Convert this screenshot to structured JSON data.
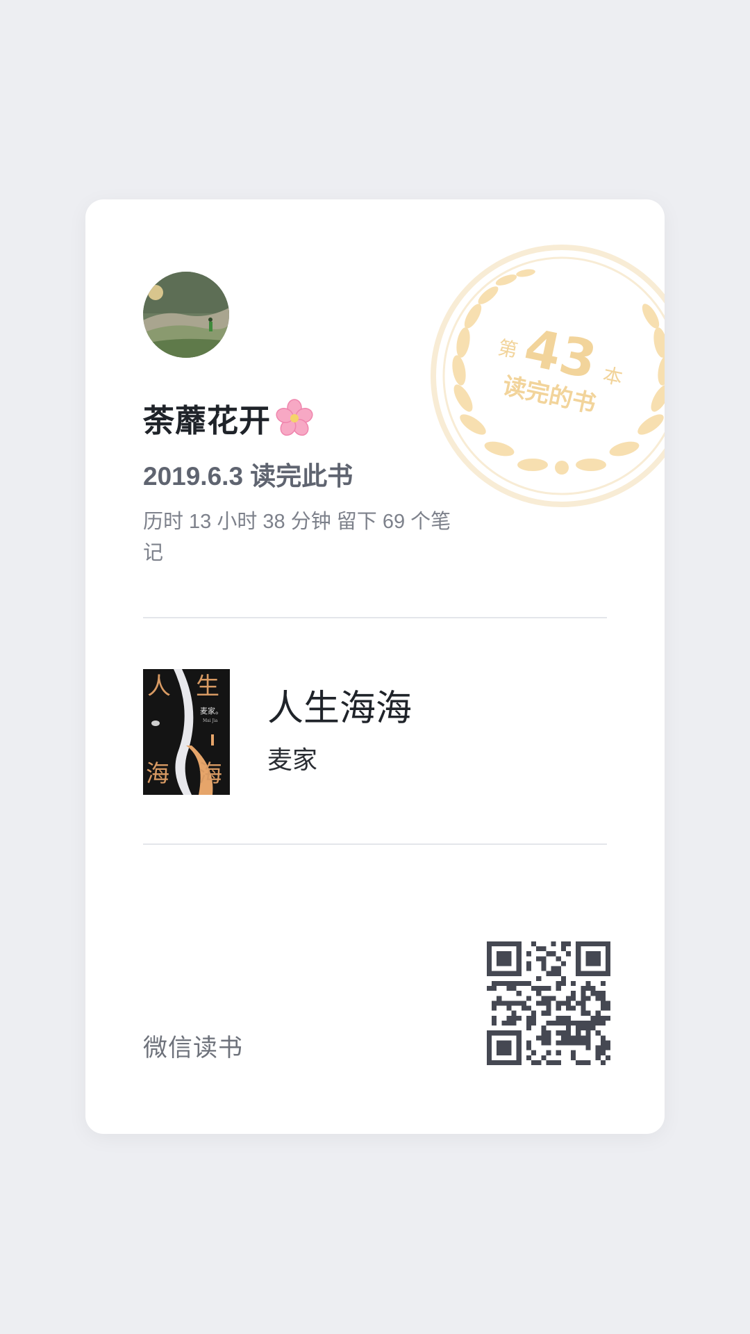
{
  "user": {
    "name": "荼蘼花开",
    "emoji": "🌸"
  },
  "badge": {
    "prefix": "第",
    "number": "43",
    "unit": "本",
    "caption": "读完的书"
  },
  "finish": {
    "date_text": "2019.6.3 读完此书",
    "stats_text": "历时 13 小时 38 分钟 留下 69 个笔记"
  },
  "book": {
    "title": "人生海海",
    "author": "麦家",
    "cover_chars": [
      "人",
      "生",
      "海",
      "海"
    ],
    "cover_author": "麦家。",
    "cover_author_latin": "Mai Jia"
  },
  "footer": {
    "app_name": "微信读书"
  },
  "colors": {
    "badge_gold": "#f5d9a4",
    "badge_ring": "#f7e6c5",
    "text_primary": "#1f2329",
    "text_secondary": "#5f6470",
    "qr_dark": "#454852"
  }
}
